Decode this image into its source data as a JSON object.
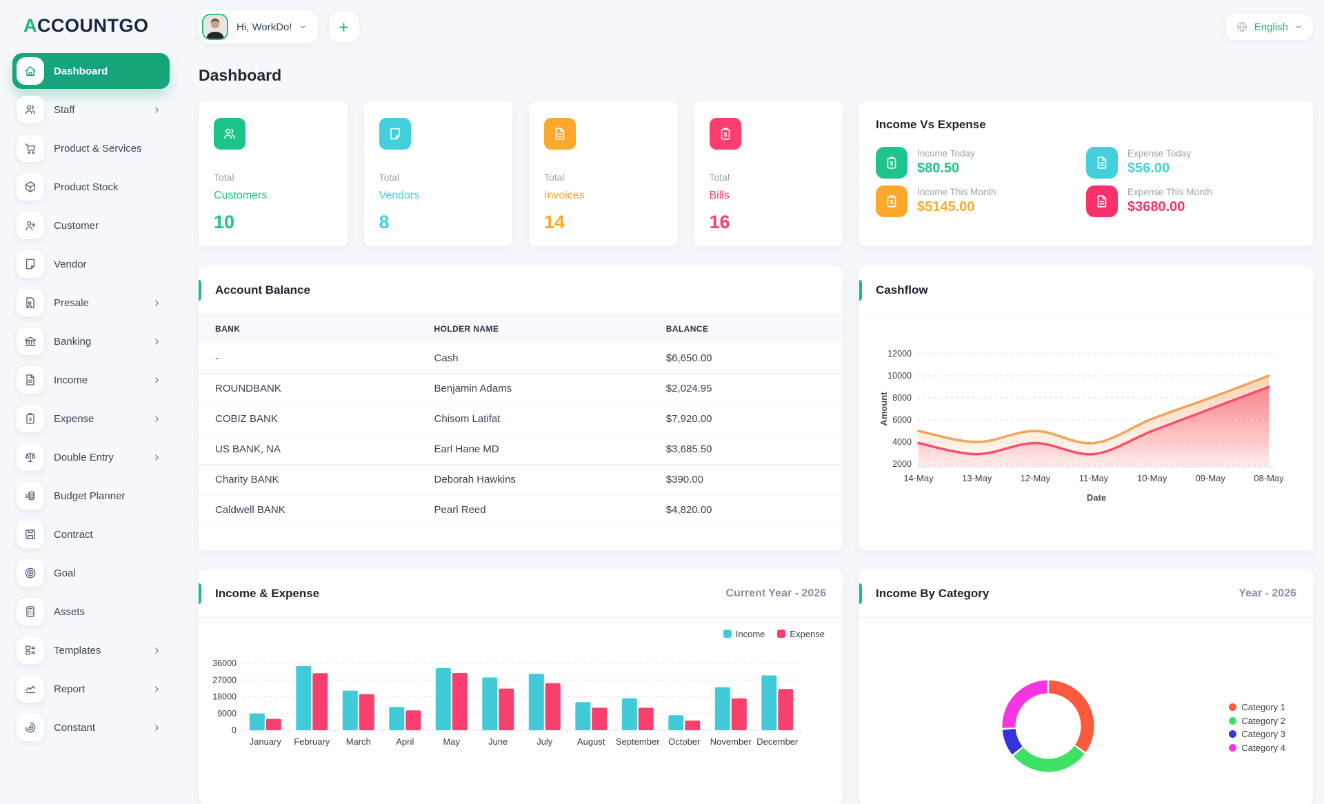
{
  "brand": {
    "logo_first": "A",
    "logo_rest": "CCOUNTGO"
  },
  "topbar": {
    "greeting": "Hi, WorkDo!",
    "add_label": "+",
    "language": "English"
  },
  "page_title": "Dashboard",
  "sidebar": {
    "items": [
      {
        "label": "Dashboard",
        "icon": "home-icon",
        "active": true,
        "has_submenu": false
      },
      {
        "label": "Staff",
        "icon": "users-icon",
        "active": false,
        "has_submenu": true
      },
      {
        "label": "Product & Services",
        "icon": "cart-icon",
        "active": false,
        "has_submenu": false
      },
      {
        "label": "Product Stock",
        "icon": "cube-icon",
        "active": false,
        "has_submenu": false
      },
      {
        "label": "Customer",
        "icon": "user-plus-icon",
        "active": false,
        "has_submenu": false
      },
      {
        "label": "Vendor",
        "icon": "note-icon",
        "active": false,
        "has_submenu": false
      },
      {
        "label": "Presale",
        "icon": "document-person-icon",
        "active": false,
        "has_submenu": true
      },
      {
        "label": "Banking",
        "icon": "bank-icon",
        "active": false,
        "has_submenu": true
      },
      {
        "label": "Income",
        "icon": "file-text-icon",
        "active": false,
        "has_submenu": true
      },
      {
        "label": "Expense",
        "icon": "clipboard-dollar-icon",
        "active": false,
        "has_submenu": true
      },
      {
        "label": "Double Entry",
        "icon": "scales-icon",
        "active": false,
        "has_submenu": true
      },
      {
        "label": "Budget Planner",
        "icon": "money-stack-icon",
        "active": false,
        "has_submenu": false
      },
      {
        "label": "Contract",
        "icon": "floppy-icon",
        "active": false,
        "has_submenu": false
      },
      {
        "label": "Goal",
        "icon": "target-icon",
        "active": false,
        "has_submenu": false
      },
      {
        "label": "Assets",
        "icon": "calculator-icon",
        "active": false,
        "has_submenu": false
      },
      {
        "label": "Templates",
        "icon": "layout-icon",
        "active": false,
        "has_submenu": true
      },
      {
        "label": "Report",
        "icon": "chart-line-icon",
        "active": false,
        "has_submenu": true
      },
      {
        "label": "Constant",
        "icon": "spiral-icon",
        "active": false,
        "has_submenu": true
      }
    ]
  },
  "stat_cards": [
    {
      "top_label": "Total",
      "name": "Customers",
      "value": "10",
      "color": "#1DC487",
      "icon": "users-icon"
    },
    {
      "top_label": "Total",
      "name": "Vendors",
      "value": "8",
      "color": "#43D0DC",
      "icon": "note-icon"
    },
    {
      "top_label": "Total",
      "name": "Invoices",
      "value": "14",
      "color": "#FBA82C",
      "icon": "file-text-icon"
    },
    {
      "top_label": "Total",
      "name": "Bills",
      "value": "16",
      "color": "#FB3E6E",
      "icon": "clipboard-dollar-icon"
    }
  ],
  "income_vs_expense": {
    "title": "Income Vs Expense",
    "items": [
      {
        "label": "Income Today",
        "value": "$80.50",
        "color": "#1FC48D",
        "icon": "clipboard-dollar-icon"
      },
      {
        "label": "Expense Today",
        "value": "$56.00",
        "color": "#43D0DC",
        "icon": "file-text-icon"
      },
      {
        "label": "Income This Month",
        "value": "$5145.00",
        "color": "#FBA82C",
        "icon": "clipboard-dollar-icon"
      },
      {
        "label": "Expense This Month",
        "value": "$3680.00",
        "color": "#F8316B",
        "icon": "file-text-icon"
      }
    ]
  },
  "account_balance": {
    "title": "Account Balance",
    "columns": [
      "BANK",
      "HOLDER NAME",
      "BALANCE"
    ],
    "rows": [
      {
        "bank": "-",
        "holder": "Cash",
        "balance": "$6,650.00"
      },
      {
        "bank": "ROUNDBANK",
        "holder": "Benjamin Adams",
        "balance": "$2,024.95"
      },
      {
        "bank": "COBIZ BANK",
        "holder": "Chisom Latifat",
        "balance": "$7,920.00"
      },
      {
        "bank": "US BANK, NA",
        "holder": "Earl Hane MD",
        "balance": "$3,685.50"
      },
      {
        "bank": "Charity BANK",
        "holder": "Deborah Hawkins",
        "balance": "$390.00"
      },
      {
        "bank": "Caldwell BANK",
        "holder": "Pearl Reed",
        "balance": "$4,820.00"
      }
    ]
  },
  "chart_data": [
    {
      "id": "cashflow",
      "type": "area",
      "title": "Cashflow",
      "xlabel": "Date",
      "ylabel": "Amount",
      "x": [
        "14-May",
        "13-May",
        "12-May",
        "11-May",
        "10-May",
        "09-May",
        "08-May"
      ],
      "ylim": [
        2000,
        12000
      ],
      "yticks": [
        12000,
        10000,
        8000,
        6000,
        4000,
        2000
      ],
      "grid": "dashed-horizontal",
      "legend": "none",
      "series": [
        {
          "name": "upper-orange",
          "color": "#F2A35B",
          "values": [
            5000,
            4000,
            5000,
            3900,
            6100,
            8000,
            10000
          ]
        },
        {
          "name": "lower-pink",
          "color": "#FB4D72",
          "values": [
            3900,
            2900,
            3900,
            2900,
            5000,
            7000,
            9000
          ]
        }
      ]
    },
    {
      "id": "income_expense",
      "type": "bar",
      "title": "Income & Expense",
      "period_label": "Current Year - 2026",
      "categories": [
        "January",
        "February",
        "March",
        "April",
        "May",
        "June",
        "July",
        "August",
        "September",
        "October",
        "November",
        "December"
      ],
      "ylim": [
        0,
        36000
      ],
      "yticks": [
        36000,
        27000,
        18000,
        9000,
        0
      ],
      "grid": "dashed-horizontal",
      "legend": "top-right",
      "series": [
        {
          "name": "Income",
          "color": "#41CBD8",
          "values": [
            9000,
            34500,
            21300,
            12500,
            33400,
            28400,
            30400,
            15100,
            17200,
            8100,
            23200,
            29500
          ]
        },
        {
          "name": "Expense",
          "color": "#F8406F",
          "values": [
            6100,
            30700,
            19400,
            10700,
            30800,
            22400,
            25300,
            12100,
            12100,
            5200,
            17200,
            22200
          ]
        }
      ]
    },
    {
      "id": "income_by_category",
      "type": "donut",
      "title": "Income By Category",
      "period_label": "Year - 2026",
      "labels": [
        "Category 1",
        "Category 2",
        "Category 3",
        "Category 4"
      ],
      "values": [
        35,
        29,
        10,
        26
      ],
      "colors": [
        "#FB5A3C",
        "#3FE066",
        "#3533DE",
        "#F935E2"
      ],
      "legend": "right"
    }
  ],
  "colors": {
    "brand_green": "#16A47B",
    "accent_bar": "#15C07A",
    "logo_navy": "#152641"
  }
}
